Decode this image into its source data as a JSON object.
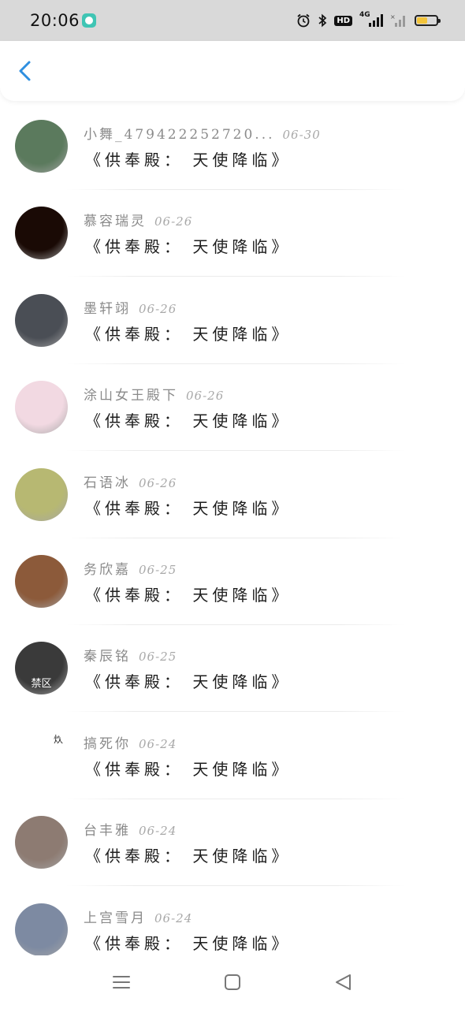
{
  "status_bar": {
    "time": "20:06",
    "network_label": "4G",
    "hd_label": "HD",
    "icons": [
      "chat-app-icon",
      "alarm-icon",
      "bluetooth-icon",
      "hd-icon",
      "signal-4g-icon",
      "signal-no-sim-icon",
      "battery-icon"
    ],
    "battery_level": 0.55,
    "battery_color": "#f3c43a"
  },
  "nav": {
    "back_icon": "chevron-left-icon",
    "accent_color": "#2f8fe0"
  },
  "messages": [
    {
      "name": "小舞_479422252720...",
      "date": "06-30",
      "text": "《供奉殿： 天使降临》",
      "avatar_color": "#5b7a5d"
    },
    {
      "name": "慕容瑞灵",
      "date": "06-26",
      "text": "《供奉殿： 天使降临》",
      "avatar_color": "#1a0a05"
    },
    {
      "name": "墨轩翊",
      "date": "06-26",
      "text": "《供奉殿： 天使降临》",
      "avatar_color": "#4a4e55"
    },
    {
      "name": "涂山女王殿下",
      "date": "06-26",
      "text": "《供奉殿： 天使降临》",
      "avatar_color": "#f2d9e2"
    },
    {
      "name": "石语冰",
      "date": "06-26",
      "text": "《供奉殿： 天使降临》",
      "avatar_color": "#b7b872"
    },
    {
      "name": "务欣嘉",
      "date": "06-25",
      "text": "《供奉殿： 天使降临》",
      "avatar_color": "#8c5a3a"
    },
    {
      "name": "秦辰铭",
      "date": "06-25",
      "text": "《供奉殿： 天使降临》",
      "avatar_color": "#3a3a3a",
      "avatar_label": "禁区"
    },
    {
      "name": "搞死你",
      "date": "06-24",
      "text": "《供奉殿： 天使降临》",
      "avatar_color": "#ffffff",
      "avatar_label": "炊"
    },
    {
      "name": "台丰雅",
      "date": "06-24",
      "text": "《供奉殿： 天使降临》",
      "avatar_color": "#8d7b72"
    },
    {
      "name": "上宫雪月",
      "date": "06-24",
      "text": "《供奉殿： 天使降临》",
      "avatar_color": "#7d8aa2"
    }
  ],
  "bottom_nav": {
    "icons": [
      "menu-icon",
      "home-square-icon",
      "back-triangle-icon"
    ]
  }
}
